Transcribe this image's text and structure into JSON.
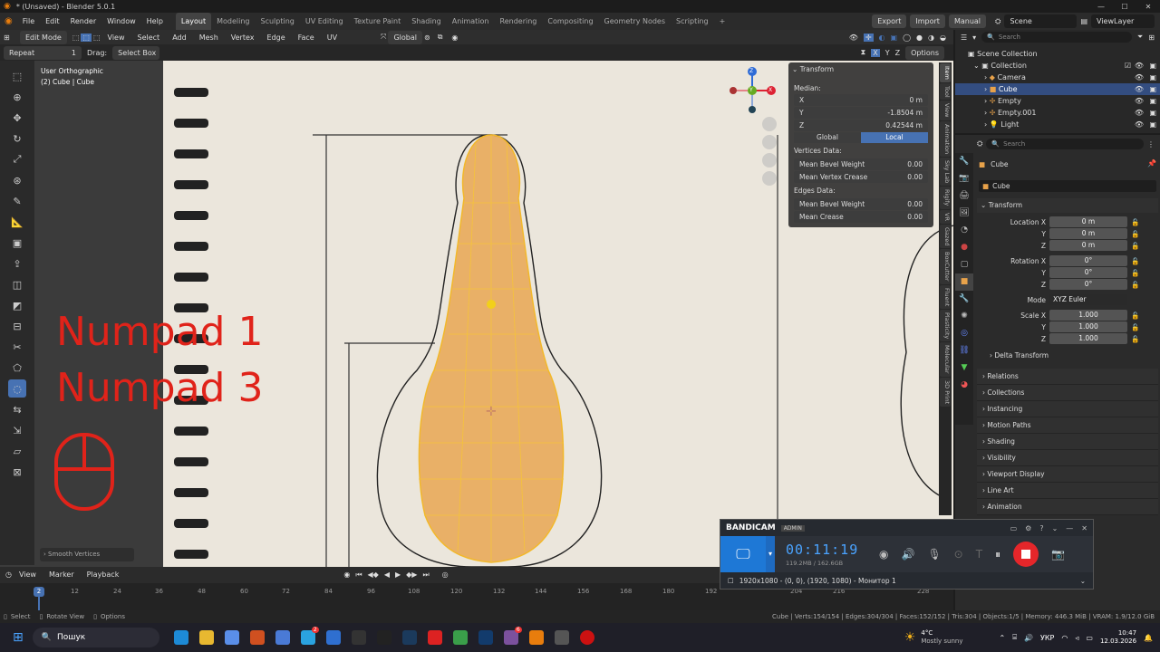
{
  "titlebar": {
    "title": "* (Unsaved) - Blender 5.0.1"
  },
  "menu": {
    "items": [
      "File",
      "Edit",
      "Render",
      "Window",
      "Help"
    ]
  },
  "workspaces": [
    "Layout",
    "Modeling",
    "Sculpting",
    "UV Editing",
    "Texture Paint",
    "Shading",
    "Animation",
    "Rendering",
    "Compositing",
    "Geometry Nodes",
    "Scripting"
  ],
  "workspace_add": "+",
  "top_right": {
    "export": "Export",
    "import": "Import",
    "manual": "Manual",
    "scene": "Scene",
    "view_layer": "ViewLayer"
  },
  "viewport_header": {
    "mode": "Edit Mode",
    "menus": [
      "View",
      "Select",
      "Add",
      "Mesh",
      "Vertex",
      "Edge",
      "Face",
      "UV"
    ],
    "orientation": "Global",
    "options": "Options",
    "axes": [
      "X",
      "Y",
      "Z"
    ]
  },
  "tool_settings": {
    "repeat_label": "Repeat",
    "repeat_value": "1",
    "drag_label": "Drag:",
    "drag_value": "Select Box"
  },
  "viewport_info": {
    "line1": "User Orthographic",
    "line2": "(2) Cube | Cube"
  },
  "overlay_text": {
    "line1": "Numpad 1",
    "line2": "Numpad 3"
  },
  "last_op": "Smooth Vertices",
  "gizmo": {
    "x": "X",
    "y": "Y",
    "z": "Z"
  },
  "npanel": {
    "title": "Transform",
    "median": "Median:",
    "fields": [
      {
        "label": "X",
        "value": "0 m"
      },
      {
        "label": "Y",
        "value": "-1.8504 m"
      },
      {
        "label": "Z",
        "value": "0.42544 m"
      }
    ],
    "toggle": {
      "global": "Global",
      "local": "Local"
    },
    "vertices_data": "Vertices Data:",
    "vfields": [
      {
        "label": "Mean Bevel Weight",
        "value": "0.00"
      },
      {
        "label": "Mean Vertex Crease",
        "value": "0.00"
      }
    ],
    "edges_data": "Edges Data:",
    "efields": [
      {
        "label": "Mean Bevel Weight",
        "value": "0.00"
      },
      {
        "label": "Mean Crease",
        "value": "0.00"
      }
    ],
    "tabs": [
      "Item",
      "Tool",
      "View",
      "Animation",
      "Sky Lab",
      "Rigify",
      "VR",
      "Gazed",
      "BoxCutter",
      "Fluent",
      "Plasticity",
      "Molecular",
      "3D Print"
    ]
  },
  "outliner": {
    "search_placeholder": "Search",
    "root": "Scene Collection",
    "collection": "Collection",
    "items": [
      "Camera",
      "Cube",
      "Empty",
      "Empty.001",
      "Light"
    ]
  },
  "properties": {
    "search_placeholder": "Search",
    "object": "Cube",
    "object_name": "Cube",
    "transform_title": "Transform",
    "location": {
      "label": "Location X",
      "x": "0 m",
      "y_label": "Y",
      "y": "0 m",
      "z_label": "Z",
      "z": "0 m"
    },
    "rotation": {
      "label": "Rotation X",
      "x": "0°",
      "y_label": "Y",
      "y": "0°",
      "z_label": "Z",
      "z": "0°"
    },
    "mode": {
      "label": "Mode",
      "value": "XYZ Euler"
    },
    "scale": {
      "label": "Scale X",
      "x": "1.000",
      "y_label": "Y",
      "y": "1.000",
      "z_label": "Z",
      "z": "1.000"
    },
    "panels": [
      "Delta Transform",
      "Relations",
      "Collections",
      "Instancing",
      "Motion Paths",
      "Shading",
      "Visibility",
      "Viewport Display",
      "Line Art",
      "Animation"
    ]
  },
  "timeline": {
    "menus": [
      "View",
      "Marker",
      "Playback"
    ],
    "current_frame": "2",
    "ticks": [
      "12",
      "24",
      "36",
      "48",
      "60",
      "72",
      "84",
      "96",
      "108",
      "120",
      "132",
      "144",
      "156",
      "168",
      "180",
      "192",
      "204",
      "216",
      "228"
    ],
    "playhead_color": "#4772b3"
  },
  "statusbar": {
    "select": "Select",
    "rotate": "Rotate View",
    "options": "Options",
    "stats": "Cube | Verts:154/154 | Edges:304/304 | Faces:152/152 | Tris:304 | Objects:1/5 | Memory: 446.3 MiB | VRAM: 1.9/12.0 GiB"
  },
  "bandicam": {
    "brand": "BANDICAM",
    "badge": "ADMIN",
    "timer": "00:11:19",
    "size": "119.2MB / 162.6GB",
    "target": "1920x1080 - (0, 0), (1920, 1080) - Монитор 1"
  },
  "taskbar": {
    "search": "Пошук",
    "weather_temp": "4°C",
    "weather_desc": "Mostly sunny",
    "lang": "УКР",
    "time": "10:47",
    "date": "12.03.2026",
    "badge1": "2",
    "badge2": "6"
  },
  "colors": {
    "accent": "#4772b3",
    "mesh_orange": "#e8a24a",
    "overlay_red": "#e0231a",
    "bg": "#1d1d1d"
  }
}
